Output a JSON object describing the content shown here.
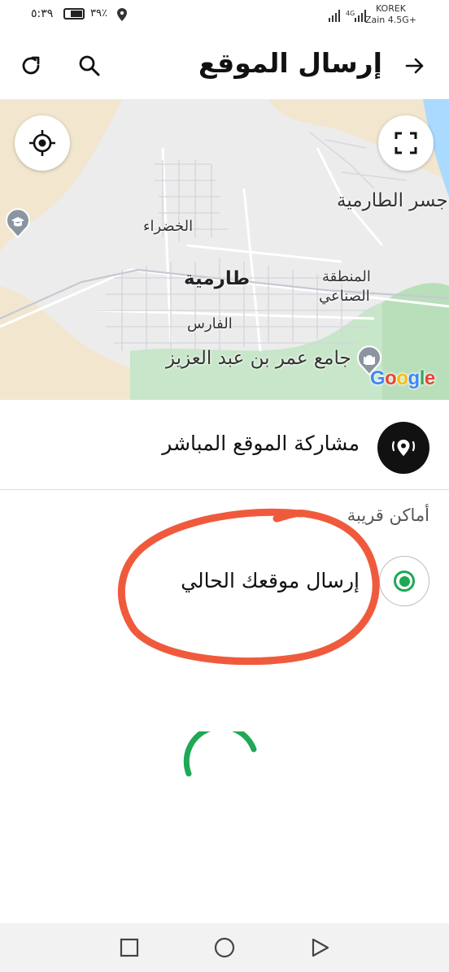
{
  "status_bar": {
    "time": "٥:٣٩",
    "battery_percent": "٣٩٪",
    "carrier_line1": "KOREK",
    "carrier_line2": "Zain 4.5G+",
    "signal_label": "4G"
  },
  "header": {
    "title": "إرسال الموقع",
    "back_icon": "arrow-right-icon",
    "search_icon": "search-icon",
    "refresh_icon": "refresh-icon"
  },
  "map": {
    "labels": {
      "bridge": "جسر الطارمية",
      "khadhra": "الخضراء",
      "tarmiya": "طارمية",
      "industrial_1": "المنطقة",
      "industrial_2": "الصناعي",
      "faris": "الفارس",
      "mosque": "جامع عمر بن عبد العزيز"
    },
    "attribution": "Google",
    "colors": {
      "green_area": "#c8e6c9",
      "water": "#aadaff",
      "sand": "#f2e6cf"
    }
  },
  "live_location": {
    "label": "مشاركة الموقع المباشر",
    "icon": "live-location-icon"
  },
  "nearby": {
    "heading": "أماكن قريبة",
    "current_location_label": "إرسال موقعك الحالي",
    "selected": true
  },
  "accent_color": "#1fa855",
  "annotation_color": "#f05a3c",
  "navbar": {
    "square": "recent-apps-icon",
    "home": "home-icon",
    "back": "back-triangle-icon"
  }
}
